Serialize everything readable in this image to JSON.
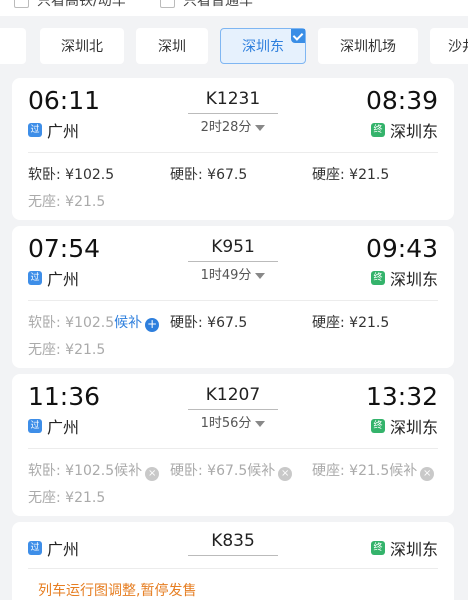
{
  "filters": {
    "high_speed_only": "只看高铁/动车",
    "regular_only": "只看普通车"
  },
  "tabs": [
    "深圳北",
    "深圳",
    "深圳东",
    "深圳机场",
    "沙井"
  ],
  "active_tab": "深圳东",
  "trains": [
    {
      "depart_time": "06:11",
      "depart_station": "广州",
      "depart_tag": "过",
      "train_no": "K1231",
      "duration": "2时28分",
      "arrive_time": "08:39",
      "arrive_station": "深圳东",
      "arrive_tag": "终",
      "seat_soft_sleeper": "软卧: ¥102.5",
      "seat_hard_sleeper": "硬卧: ¥67.5",
      "seat_hard_seat": "硬座: ¥21.5",
      "seat_no_seat": "无座: ¥21.5"
    },
    {
      "depart_time": "07:54",
      "depart_station": "广州",
      "depart_tag": "过",
      "train_no": "K951",
      "duration": "1时49分",
      "arrive_time": "09:43",
      "arrive_station": "深圳东",
      "arrive_tag": "终",
      "seat_soft_sleeper": "软卧: ¥102.5",
      "soft_sleeper_waitlist": "候补",
      "seat_hard_sleeper": "硬卧: ¥67.5",
      "seat_hard_seat": "硬座: ¥21.5",
      "seat_no_seat": "无座: ¥21.5"
    },
    {
      "depart_time": "11:36",
      "depart_station": "广州",
      "depart_tag": "过",
      "train_no": "K1207",
      "duration": "1时56分",
      "arrive_time": "13:32",
      "arrive_station": "深圳东",
      "arrive_tag": "终",
      "seat_soft_sleeper": "软卧: ¥102.5候补",
      "seat_hard_sleeper": "硬卧: ¥67.5候补",
      "seat_hard_seat": "硬座: ¥21.5候补",
      "seat_no_seat": "无座: ¥21.5"
    },
    {
      "depart_station": "广州",
      "depart_tag": "过",
      "train_no": "K835",
      "arrive_station": "深圳东",
      "arrive_tag": "终",
      "notice": "列车运行图调整,暂停发售"
    }
  ],
  "colors": {
    "accent": "#2e7fdd",
    "pass_tag": "#3e8ee8",
    "end_tag": "#34b36b",
    "notice": "#e67e22"
  }
}
